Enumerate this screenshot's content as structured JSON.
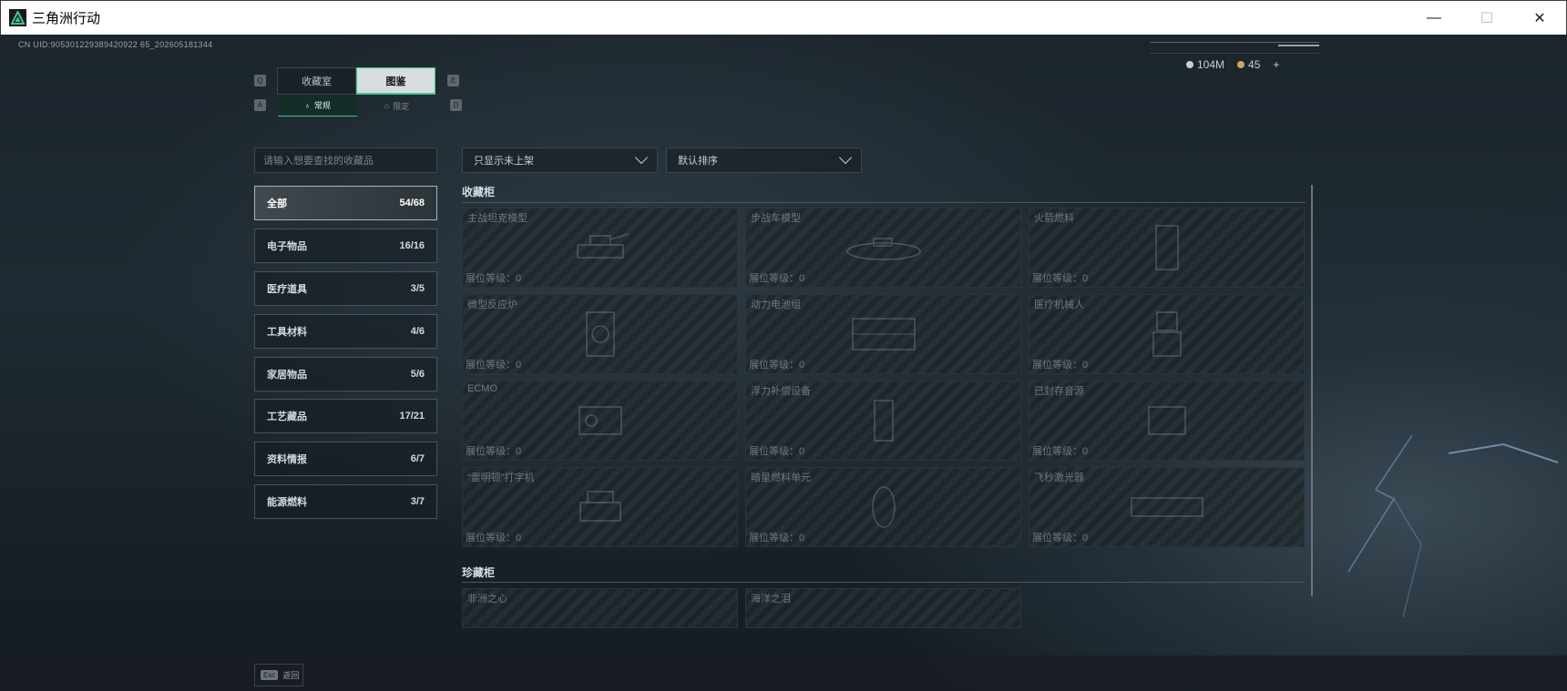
{
  "window": {
    "title": "三角洲行动",
    "minimize": "—",
    "maximize": "☐",
    "close": "✕"
  },
  "uid": "CN UID:905301229389420922 65_202605181344",
  "currency": {
    "silver": "104M",
    "gold": "45",
    "add": "+"
  },
  "tabs": {
    "prev_key": "Q",
    "next_key": "E",
    "items": [
      {
        "label": "收藏室"
      },
      {
        "label": "图鉴"
      }
    ]
  },
  "subtabs": {
    "prev_key": "A",
    "next_key": "D",
    "items": [
      {
        "label": "常规"
      },
      {
        "label": "限定"
      }
    ]
  },
  "search": {
    "placeholder": "请输入想要查找的收藏品"
  },
  "filters": {
    "show": "只显示未上架",
    "sort": "默认排序"
  },
  "categories": [
    {
      "label": "全部",
      "count": "54/68"
    },
    {
      "label": "电子物品",
      "count": "16/16"
    },
    {
      "label": "医疗道具",
      "count": "3/5"
    },
    {
      "label": "工具材料",
      "count": "4/6"
    },
    {
      "label": "家居物品",
      "count": "5/6"
    },
    {
      "label": "工艺藏品",
      "count": "17/21"
    },
    {
      "label": "资料情报",
      "count": "6/7"
    },
    {
      "label": "能源燃料",
      "count": "3/7"
    }
  ],
  "sections": {
    "cabinet": {
      "title": "收藏柜",
      "items": [
        {
          "name": "主战坦克模型",
          "level": "展位等级：0"
        },
        {
          "name": "步战车模型",
          "level": "展位等级：0"
        },
        {
          "name": "火箭燃料",
          "level": "展位等级：0"
        },
        {
          "name": "微型反应炉",
          "level": "展位等级：0"
        },
        {
          "name": "动力电池组",
          "level": "展位等级：0"
        },
        {
          "name": "医疗机械人",
          "level": "展位等级：0"
        },
        {
          "name": "ECMO",
          "level": "展位等级：0"
        },
        {
          "name": "浮力补偿设备",
          "level": "展位等级：0"
        },
        {
          "name": "已封存音源",
          "level": "展位等级：0"
        },
        {
          "name": "“雷明顿”打字机",
          "level": "展位等级：0"
        },
        {
          "name": "暗星燃料单元",
          "level": "展位等级：0"
        },
        {
          "name": "飞秒激光器",
          "level": "展位等级：0"
        }
      ]
    },
    "treasure": {
      "title": "珍藏柜",
      "items": [
        {
          "name": "非洲之心"
        },
        {
          "name": "海洋之泪"
        }
      ]
    }
  },
  "footer": {
    "esc_key": "Esc",
    "back": "返回"
  },
  "colors": {
    "accent": "#41c48d",
    "panel_border": "#4a535a",
    "text_muted": "#6e787e"
  }
}
